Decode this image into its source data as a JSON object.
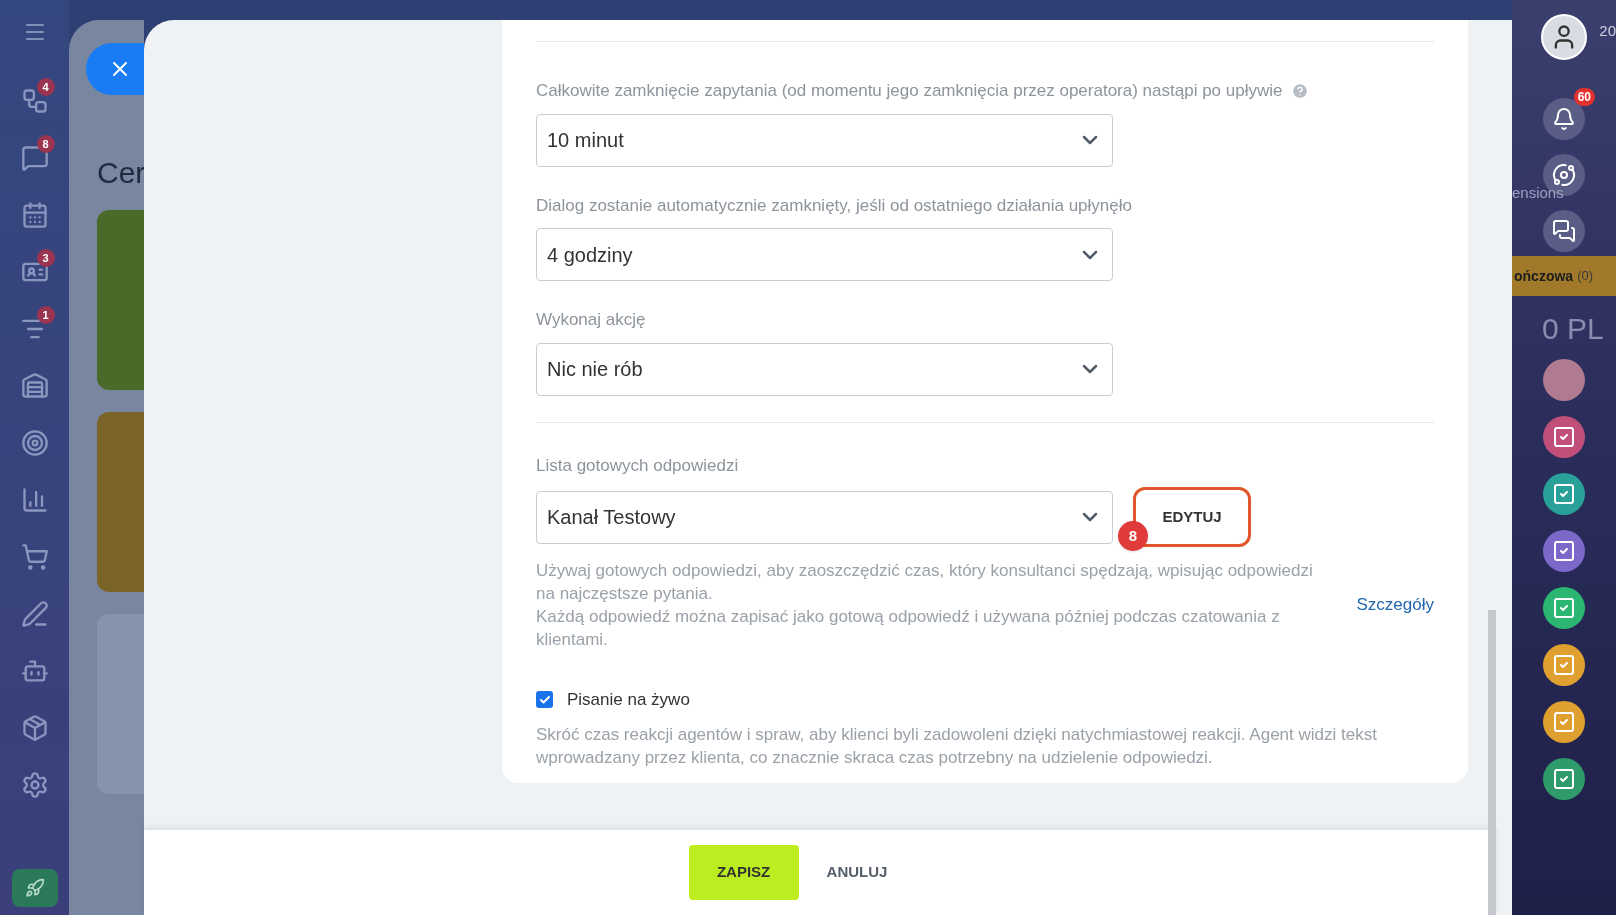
{
  "left_nav": {
    "badges": [
      "4",
      "8",
      "3",
      "1"
    ]
  },
  "background_page": {
    "heading": "Cer"
  },
  "form": {
    "fields": [
      {
        "label": "Całkowite zamknięcie zapytania (od momentu jego zamknięcia przez operatora) nastąpi po upływie",
        "help": true,
        "value": "10 minut"
      },
      {
        "label": "Dialog zostanie automatycznie zamknięty, jeśli od ostatniego działania upłynęło",
        "help": false,
        "value": "4 godziny"
      },
      {
        "label": "Wykonaj akcję",
        "help": false,
        "value": "Nic nie rób"
      }
    ],
    "answers": {
      "label": "Lista gotowych odpowiedzi",
      "value": "Kanał Testowy",
      "edit_button": "EDYTUJ",
      "marker": "8",
      "description": [
        "Używaj gotowych odpowiedzi, aby zaoszczędzić czas, który konsultanci spędzają, wpisując odpowiedzi na najczęstsze pytania.",
        "Każdą odpowiedź można zapisać jako gotową odpowiedź i używana później podczas czatowania z klientami."
      ],
      "link": "Szczegóły"
    },
    "live_typing": {
      "label": "Pisanie na żywo",
      "checked": true,
      "description": "Skróć czas reakcji agentów i spraw, aby klienci byli zadowoleni dzięki natychmiastowej reakcji. Agent widzi tekst wprowadzany przez klienta, co znacznie skraca czas potrzebny na udzielenie odpowiedzi."
    }
  },
  "footer": {
    "buttons": [
      {
        "label": "ZAPISZ",
        "kind": "primary"
      },
      {
        "label": "ANULUJ",
        "kind": "link"
      }
    ]
  },
  "right_bar": {
    "notification_badge": "60",
    "top_badge": "20",
    "texts": [
      "ensions"
    ],
    "stage": {
      "name": "ończowa",
      "count": "(0)"
    },
    "amount": "0 PL",
    "apps": [
      {
        "color": "#c0507a"
      },
      {
        "color": "#2aa198"
      },
      {
        "color": "#7b68c8"
      },
      {
        "color": "#2bb673"
      },
      {
        "color": "#e0a030"
      },
      {
        "color": "#e0a030"
      },
      {
        "color": "#2f9a6a"
      }
    ]
  }
}
